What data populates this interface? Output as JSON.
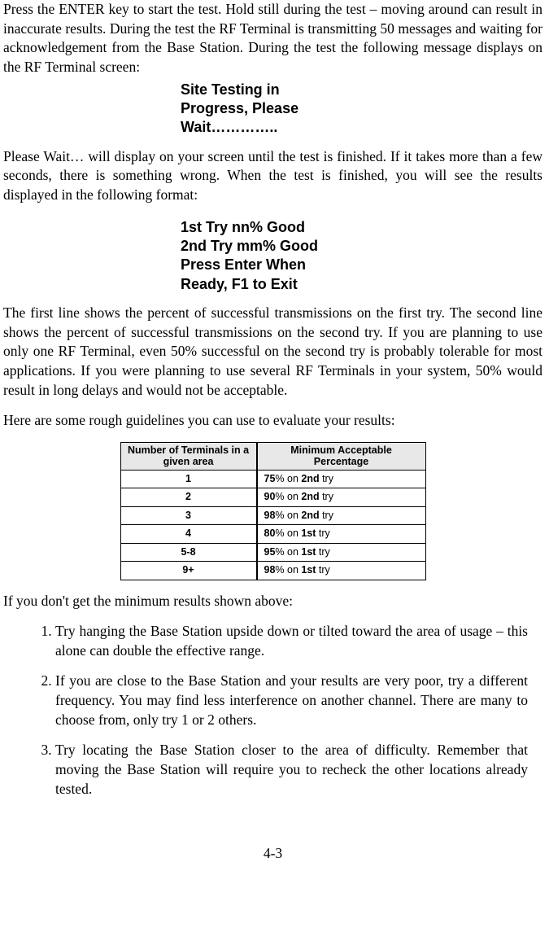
{
  "para1": "Press the ENTER key to start the test. Hold still during the test – moving around can result in inaccurate results. During the test the RF Terminal is transmitting 50 messages and waiting for acknowledgement from the Base Station. During the test the following message displays on the RF Terminal screen:",
  "screen1": {
    "l1": "Site Testing in",
    "l2": "Progress, Please",
    "l3": "Wait………….."
  },
  "para2": "Please Wait… will display on your screen until the test is finished. If it takes more than a few seconds, there is something wrong. When the test is finished, you will see the results displayed in the following format:",
  "screen2": {
    "l1": "1st Try nn% Good",
    "l2": "2nd Try mm% Good",
    "l3": "Press Enter When",
    "l4": "Ready, F1 to Exit"
  },
  "para3": "The first line shows the percent of successful transmissions on the first try. The second line shows the percent of successful transmissions on the second try. If you are planning to use only one RF Terminal, even 50% successful on the second try is probably tolerable for most applications.  If you were planning to use several RF Terminals in your system, 50% would result in long delays and would not be acceptable.",
  "para4": "Here are some rough guidelines you can use to evaluate your results:",
  "table": {
    "h1": "Number of Terminals in a given area",
    "h2": "Minimum Acceptable Percentage",
    "rows": [
      {
        "n": "1",
        "p": "75",
        "t": "2nd"
      },
      {
        "n": "2",
        "p": "90",
        "t": "2nd"
      },
      {
        "n": "3",
        "p": "98",
        "t": "2nd"
      },
      {
        "n": "4",
        "p": "80",
        "t": "1st"
      },
      {
        "n": "5-8",
        "p": "95",
        "t": "1st"
      },
      {
        "n": "9+",
        "p": "98",
        "t": "1st"
      }
    ]
  },
  "para5": "If you don't get the minimum results shown above:",
  "steps": {
    "s1": "Try hanging the Base Station upside down or tilted toward the area of usage – this alone can double the effective range.",
    "s2": "If you are close to the Base Station and your results are very poor, try a different frequency. You may find less interference on another channel.  There are many to choose from, only try 1 or 2 others.",
    "s3": "Try locating the Base Station closer to the area of difficulty. Remember that moving the Base Station will require you to recheck the other locations already tested."
  },
  "pagenum": "4-3"
}
